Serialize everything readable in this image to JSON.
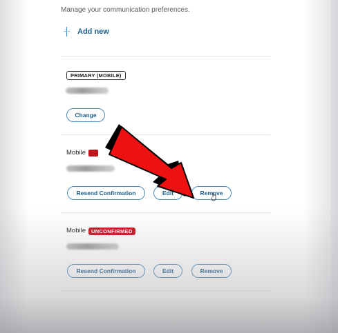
{
  "header": {
    "subtitle": "Manage your communication preferences."
  },
  "add_new": {
    "label": "Add new",
    "icon": "plus-icon"
  },
  "entries": [
    {
      "badge": "PRIMARY (MOBILE)",
      "buttons": {
        "change": "Change"
      }
    },
    {
      "type_label": "Mobile",
      "buttons": {
        "resend": "Resend Confirmation",
        "edit": "Edit",
        "remove": "Remove"
      }
    },
    {
      "type_label": "Mobile",
      "status_badge": "UNCONFIRMED",
      "buttons": {
        "resend": "Resend Confirmation",
        "edit": "Edit",
        "remove": "Remove"
      }
    }
  ],
  "colors": {
    "link_blue": "#1a5f8c",
    "button_border": "#4d8fbf",
    "unconfirmed_red": "#c0141c",
    "annotation_arrow": "#ee1111"
  },
  "annotation": {
    "icon": "red-arrow-pointing-to-remove"
  }
}
